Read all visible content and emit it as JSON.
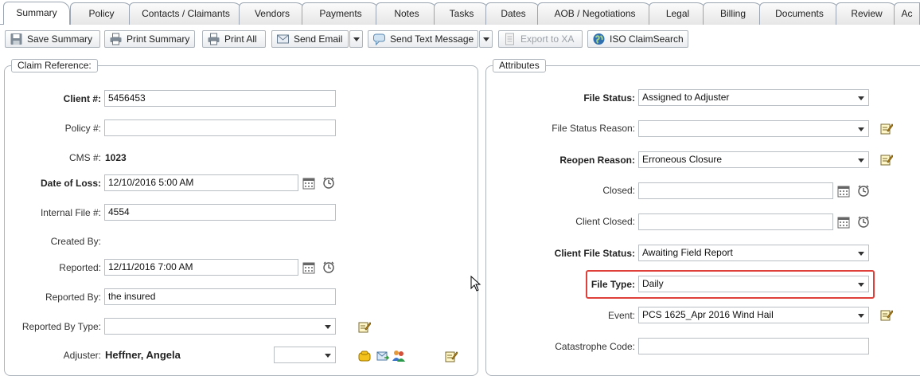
{
  "tabs": [
    {
      "label": "Summary",
      "active": true
    },
    {
      "label": "Policy"
    },
    {
      "label": "Contacts / Claimants"
    },
    {
      "label": "Vendors"
    },
    {
      "label": "Payments"
    },
    {
      "label": "Notes"
    },
    {
      "label": "Tasks"
    },
    {
      "label": "Dates"
    },
    {
      "label": "AOB / Negotiations"
    },
    {
      "label": "Legal"
    },
    {
      "label": "Billing"
    },
    {
      "label": "Documents"
    },
    {
      "label": "Review"
    },
    {
      "label": "Ac"
    }
  ],
  "toolbar": {
    "save_summary": "Save Summary",
    "print_summary": "Print Summary",
    "print_all": "Print All",
    "send_email": "Send Email",
    "send_text": "Send Text Message",
    "export_xa": "Export to XA",
    "iso_claimsearch": "ISO ClaimSearch"
  },
  "claim_reference": {
    "title": "Claim Reference:",
    "client_label": "Client #:",
    "client_value": "5456453",
    "policy_label": "Policy #:",
    "policy_value": "",
    "cms_label": "CMS #:",
    "cms_value": "1023",
    "date_of_loss_label": "Date of Loss:",
    "date_of_loss_value": "12/10/2016 5:00 AM",
    "internal_file_label": "Internal File #:",
    "internal_file_value": "4554",
    "created_by_label": "Created By:",
    "reported_label": "Reported:",
    "reported_value": "12/11/2016 7:00 AM",
    "reported_by_label": "Reported By:",
    "reported_by_value": "the insured",
    "reported_by_type_label": "Reported By Type:",
    "reported_by_type_value": "",
    "adjuster_label": "Adjuster:",
    "adjuster_value": "Heffner, Angela",
    "adjuster_select_value": ""
  },
  "attributes": {
    "title": "Attributes",
    "file_status_label": "File Status:",
    "file_status_value": "Assigned to Adjuster",
    "file_status_reason_label": "File Status Reason:",
    "file_status_reason_value": "",
    "reopen_reason_label": "Reopen Reason:",
    "reopen_reason_value": "Erroneous Closure",
    "closed_label": "Closed:",
    "closed_value": "",
    "client_closed_label": "Client Closed:",
    "client_closed_value": "",
    "client_file_status_label": "Client File Status:",
    "client_file_status_value": "Awaiting Field Report",
    "file_type_label": "File Type:",
    "file_type_value": "Daily",
    "event_label": "Event:",
    "event_value": "PCS 1625_Apr 2016 Wind Hail",
    "catastrophe_code_label": "Catastrophe Code:",
    "catastrophe_code_value": ""
  },
  "colors": {
    "highlight": "#e0403a",
    "border": "#aeb4bb"
  }
}
